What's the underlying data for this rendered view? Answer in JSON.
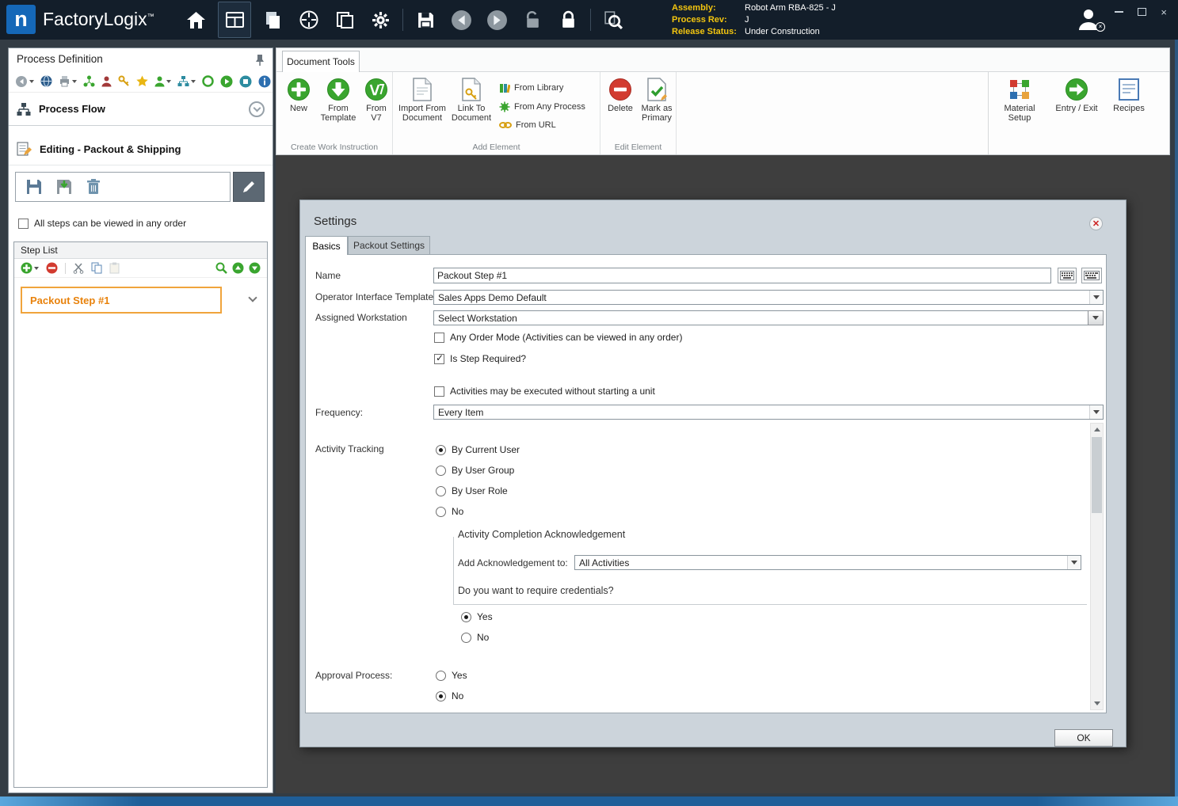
{
  "colors": {
    "accent_orange": "#E8820C",
    "titlebar_bg": "#131E2A",
    "brand_blue": "#1568B8",
    "label_yellow": "#F3C50F",
    "dialog_bg": "#CCD4DB",
    "canvas_bg": "#3E3E3E",
    "action_green": "#35A52C",
    "action_red": "#D23B30"
  },
  "titlebar": {
    "logo_letter": "n",
    "brand": "FactoryLogix",
    "trademark": "™",
    "assembly_label": "Assembly:",
    "assembly_value": "Robot Arm RBA-825 - J",
    "process_rev_label": "Process Rev:",
    "process_rev_value": "J",
    "release_status_label": "Release Status:",
    "release_status_value": "Under Construction",
    "close_glyph": "×"
  },
  "left_panel": {
    "title": "Process Definition",
    "process_flow_label": "Process Flow",
    "editing_label": "Editing - Packout & Shipping",
    "any_order_label": "All steps can be viewed in any order",
    "step_list_title": "Step List",
    "steps": [
      {
        "label": "Packout Step #1"
      }
    ]
  },
  "ribbon": {
    "tab_label": "Document Tools",
    "create_group": {
      "title": "Create Work Instruction",
      "new_label": "New",
      "from_template_label": "From Template",
      "from_v7_label": "From V7"
    },
    "add_group": {
      "title": "Add Element",
      "import_label": "Import From Document",
      "link_label": "Link To Document",
      "from_library_label": "From Library",
      "from_any_process_label": "From Any Process",
      "from_url_label": "From URL"
    },
    "edit_group": {
      "title": "Edit Element",
      "delete_label": "Delete",
      "mark_primary_label": "Mark as Primary"
    },
    "right_group": {
      "material_setup_label": "Material Setup",
      "entry_exit_label": "Entry / Exit",
      "recipes_label": "Recipes"
    }
  },
  "dialog": {
    "title": "Settings",
    "tabs": {
      "basics": "Basics",
      "packout": "Packout Settings"
    },
    "name_label": "Name",
    "name_value": "Packout Step #1",
    "oit_label": "Operator Interface Template",
    "oit_value": "Sales Apps Demo Default",
    "workstation_label": "Assigned Workstation",
    "workstation_value": "Select Workstation",
    "any_order_mode_label": "Any Order Mode (Activities can be viewed in any order)",
    "is_step_required_label": "Is Step Required?",
    "activities_without_unit_label": "Activities may be executed without starting a unit",
    "frequency_label": "Frequency:",
    "frequency_value": "Every Item",
    "activity_tracking_label": "Activity Tracking",
    "tracking_options": [
      "By Current User",
      "By User Group",
      "By User Role",
      "No"
    ],
    "tracking_selected": "By Current User",
    "ack_section_title": "Activity Completion Acknowledgement",
    "ack_label": "Add Acknowledgement to:",
    "ack_value": "All Activities",
    "credentials_question": "Do you want to require credentials?",
    "credentials_yes": "Yes",
    "credentials_no": "No",
    "credentials_selected": "Yes",
    "approval_label": "Approval Process:",
    "approval_yes": "Yes",
    "approval_no": "No",
    "approval_selected": "No",
    "ok_label": "OK"
  }
}
